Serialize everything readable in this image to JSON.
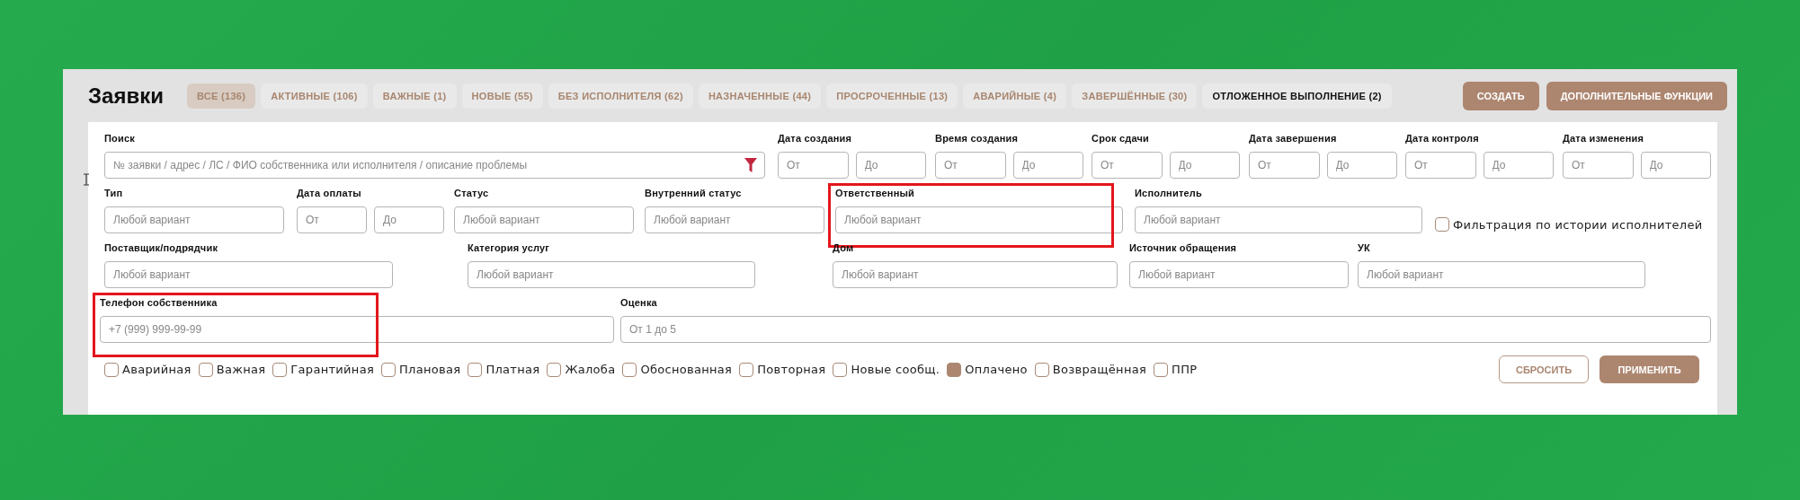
{
  "header": {
    "title": "Заявки"
  },
  "tabs": [
    {
      "label": "ВСЕ (136)",
      "selected": true,
      "hovered": false
    },
    {
      "label": "АКТИВНЫЕ (106)",
      "selected": false,
      "hovered": false
    },
    {
      "label": "ВАЖНЫЕ (1)",
      "selected": false,
      "hovered": false
    },
    {
      "label": "НОВЫЕ (55)",
      "selected": false,
      "hovered": false
    },
    {
      "label": "БЕЗ ИСПОЛНИТЕЛЯ (62)",
      "selected": false,
      "hovered": false
    },
    {
      "label": "НАЗНАЧЕННЫЕ (44)",
      "selected": false,
      "hovered": false
    },
    {
      "label": "ПРОСРОЧЕННЫЕ (13)",
      "selected": false,
      "hovered": false
    },
    {
      "label": "АВАРИЙНЫЕ (4)",
      "selected": false,
      "hovered": false
    },
    {
      "label": "ЗАВЕРШЁННЫЕ (30)",
      "selected": false,
      "hovered": false
    },
    {
      "label": "ОТЛОЖЕННОЕ ВЫПОЛНЕНИЕ (2)",
      "selected": false,
      "hovered": true
    }
  ],
  "actions": [
    {
      "label": "СОЗДАТЬ"
    },
    {
      "label": "ДОПОЛНИТЕЛЬНЫЕ ФУНКЦИИ"
    }
  ],
  "rows": [
    {
      "fields": [
        {
          "kind": "search",
          "label": "Поиск",
          "placeholder": "№ заявки / адрес / ЛС / ФИО собственника или исполнителя / описание проблемы",
          "highlighted": false
        },
        {
          "kind": "range",
          "label": "Дата создания",
          "from_placeholder": "От",
          "to_placeholder": "До",
          "highlighted": false
        },
        {
          "kind": "range",
          "label": "Время создания",
          "from_placeholder": "От",
          "to_placeholder": "До",
          "highlighted": false
        },
        {
          "kind": "range",
          "label": "Срок сдачи",
          "from_placeholder": "От",
          "to_placeholder": "До",
          "highlighted": false
        },
        {
          "kind": "range",
          "label": "Дата завершения",
          "from_placeholder": "От",
          "to_placeholder": "До",
          "highlighted": false
        },
        {
          "kind": "range",
          "label": "Дата контроля",
          "from_placeholder": "От",
          "to_placeholder": "До",
          "highlighted": false
        },
        {
          "kind": "range",
          "label": "Дата изменения",
          "from_placeholder": "От",
          "to_placeholder": "До",
          "highlighted": false
        }
      ]
    },
    {
      "fields": [
        {
          "kind": "select",
          "label": "Тип",
          "placeholder": "Любой вариант",
          "highlighted": false
        },
        {
          "kind": "range",
          "label": "Дата оплаты",
          "from_placeholder": "От",
          "to_placeholder": "До",
          "highlighted": false
        },
        {
          "kind": "select",
          "label": "Статус",
          "placeholder": "Любой вариант",
          "highlighted": false
        },
        {
          "kind": "select",
          "label": "Внутренний статус",
          "placeholder": "Любой вариант",
          "highlighted": false
        },
        {
          "kind": "select",
          "label": "Ответственный",
          "placeholder": "Любой вариант",
          "highlighted": true
        },
        {
          "kind": "select",
          "label": "Исполнитель",
          "placeholder": "Любой вариант",
          "highlighted": false
        },
        {
          "kind": "checkbox",
          "label": "Фильтрация по истории исполнителей",
          "checked": false
        }
      ]
    },
    {
      "fields": [
        {
          "kind": "select",
          "label": "Поставщик/подрядчик",
          "placeholder": "Любой вариант",
          "highlighted": false
        },
        {
          "kind": "select",
          "label": "Категория услуг",
          "placeholder": "Любой вариант",
          "highlighted": false
        },
        {
          "kind": "select",
          "label": "Дом",
          "placeholder": "Любой вариант",
          "highlighted": false
        },
        {
          "kind": "select",
          "label": "Источник обращения",
          "placeholder": "Любой вариант",
          "highlighted": false
        },
        {
          "kind": "select",
          "label": "УК",
          "placeholder": "Любой вариант",
          "highlighted": false
        }
      ]
    },
    {
      "fields": [
        {
          "kind": "text",
          "label": "Телефон собственника",
          "placeholder": "+7 (999) 999-99-99",
          "highlighted": true
        },
        {
          "kind": "text",
          "label": "Оценка",
          "placeholder": "От 1 до 5",
          "highlighted": false
        }
      ]
    }
  ],
  "flags": [
    {
      "label": "Аварийная",
      "checked": false
    },
    {
      "label": "Важная",
      "checked": false
    },
    {
      "label": "Гарантийная",
      "checked": false
    },
    {
      "label": "Плановая",
      "checked": false
    },
    {
      "label": "Платная",
      "checked": false
    },
    {
      "label": "Жалоба",
      "checked": false
    },
    {
      "label": "Обоснованная",
      "checked": false
    },
    {
      "label": "Повторная",
      "checked": false
    },
    {
      "label": "Новые сообщ.",
      "checked": false
    },
    {
      "label": "Оплачено",
      "checked": true
    },
    {
      "label": "Возвращённая",
      "checked": false
    },
    {
      "label": "ППР",
      "checked": false
    }
  ],
  "buttons": [
    {
      "kind": "secondary",
      "label": "СБРОСИТЬ"
    },
    {
      "kind": "primary",
      "label": "ПРИМЕНИТЬ"
    }
  ]
}
